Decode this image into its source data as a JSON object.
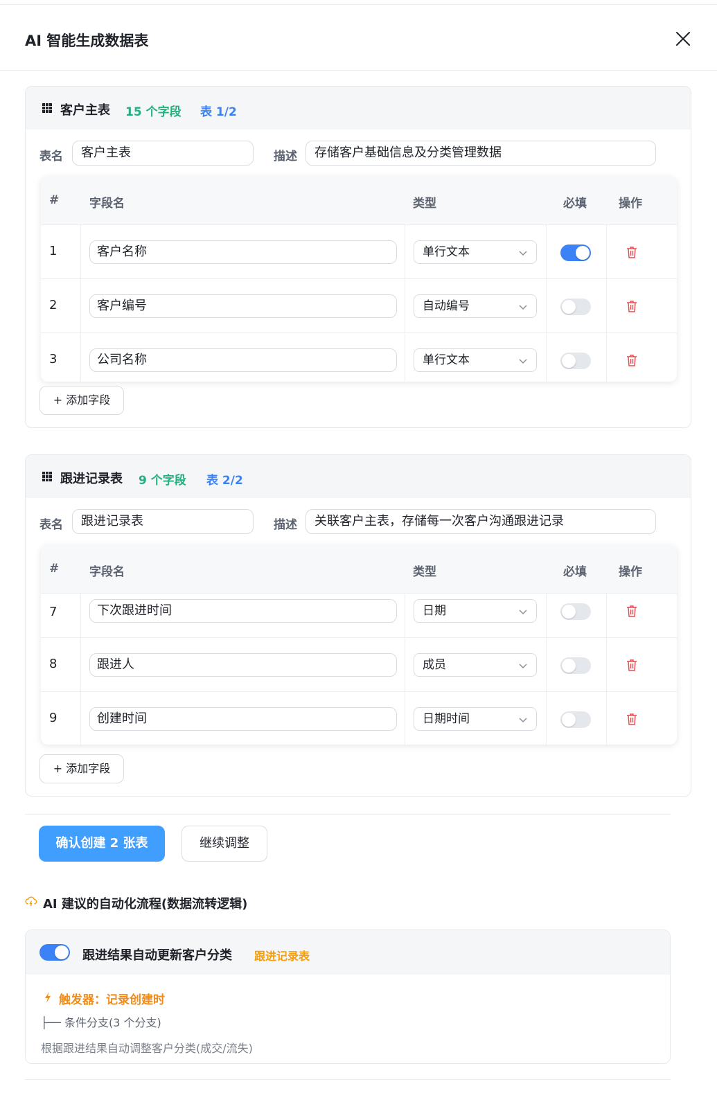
{
  "dialog": {
    "title": "AI 智能生成数据表"
  },
  "tables": [
    {
      "title": "客户主表",
      "field_count": "15 个字段",
      "index": "表 1/2",
      "name_label": "表名",
      "name_value": "客户主表",
      "desc_label": "描述",
      "desc_value": "存储客户基础信息及分类管理数据",
      "headers": {
        "num": "#",
        "name": "字段名",
        "type": "类型",
        "required": "必填",
        "action": "操作"
      },
      "rows": [
        {
          "num": "1",
          "name": "客户名称",
          "type": "单行文本",
          "required": true
        },
        {
          "num": "2",
          "name": "客户编号",
          "type": "自动编号",
          "required": false
        },
        {
          "num": "3",
          "name": "公司名称",
          "type": "单行文本",
          "required": false
        }
      ],
      "add_label": "+ 添加字段"
    },
    {
      "title": "跟进记录表",
      "field_count": "9 个字段",
      "index": "表 2/2",
      "name_label": "表名",
      "name_value": "跟进记录表",
      "desc_label": "描述",
      "desc_value": "关联客户主表，存储每一次客户沟通跟进记录",
      "headers": {
        "num": "#",
        "name": "字段名",
        "type": "类型",
        "required": "必填",
        "action": "操作"
      },
      "rows": [
        {
          "num": "7",
          "name": "下次跟进时间",
          "type": "日期",
          "required": false
        },
        {
          "num": "8",
          "name": "跟进人",
          "type": "成员",
          "required": false
        },
        {
          "num": "9",
          "name": "创建时间",
          "type": "日期时间",
          "required": false
        }
      ],
      "add_label": "+ 添加字段"
    }
  ],
  "actions": {
    "confirm_label": "确认创建 2 张表",
    "adjust_label": "继续调整"
  },
  "automation": {
    "section_title": "AI 建议的自动化流程(数据流转逻辑)",
    "flow": {
      "enabled": true,
      "title": "跟进结果自动更新客户分类",
      "table": "跟进记录表",
      "trigger": "触发器：记录创建时",
      "branch": "├── 条件分支(3 个分支)",
      "description": "根据跟进结果自动调整客户分类(成交/流失)"
    }
  },
  "colors": {
    "primary": "#409eff",
    "toggle_on": "#3b82f6",
    "green": "#22b07d",
    "orange": "#f59e0b",
    "danger": "#e5484d"
  }
}
